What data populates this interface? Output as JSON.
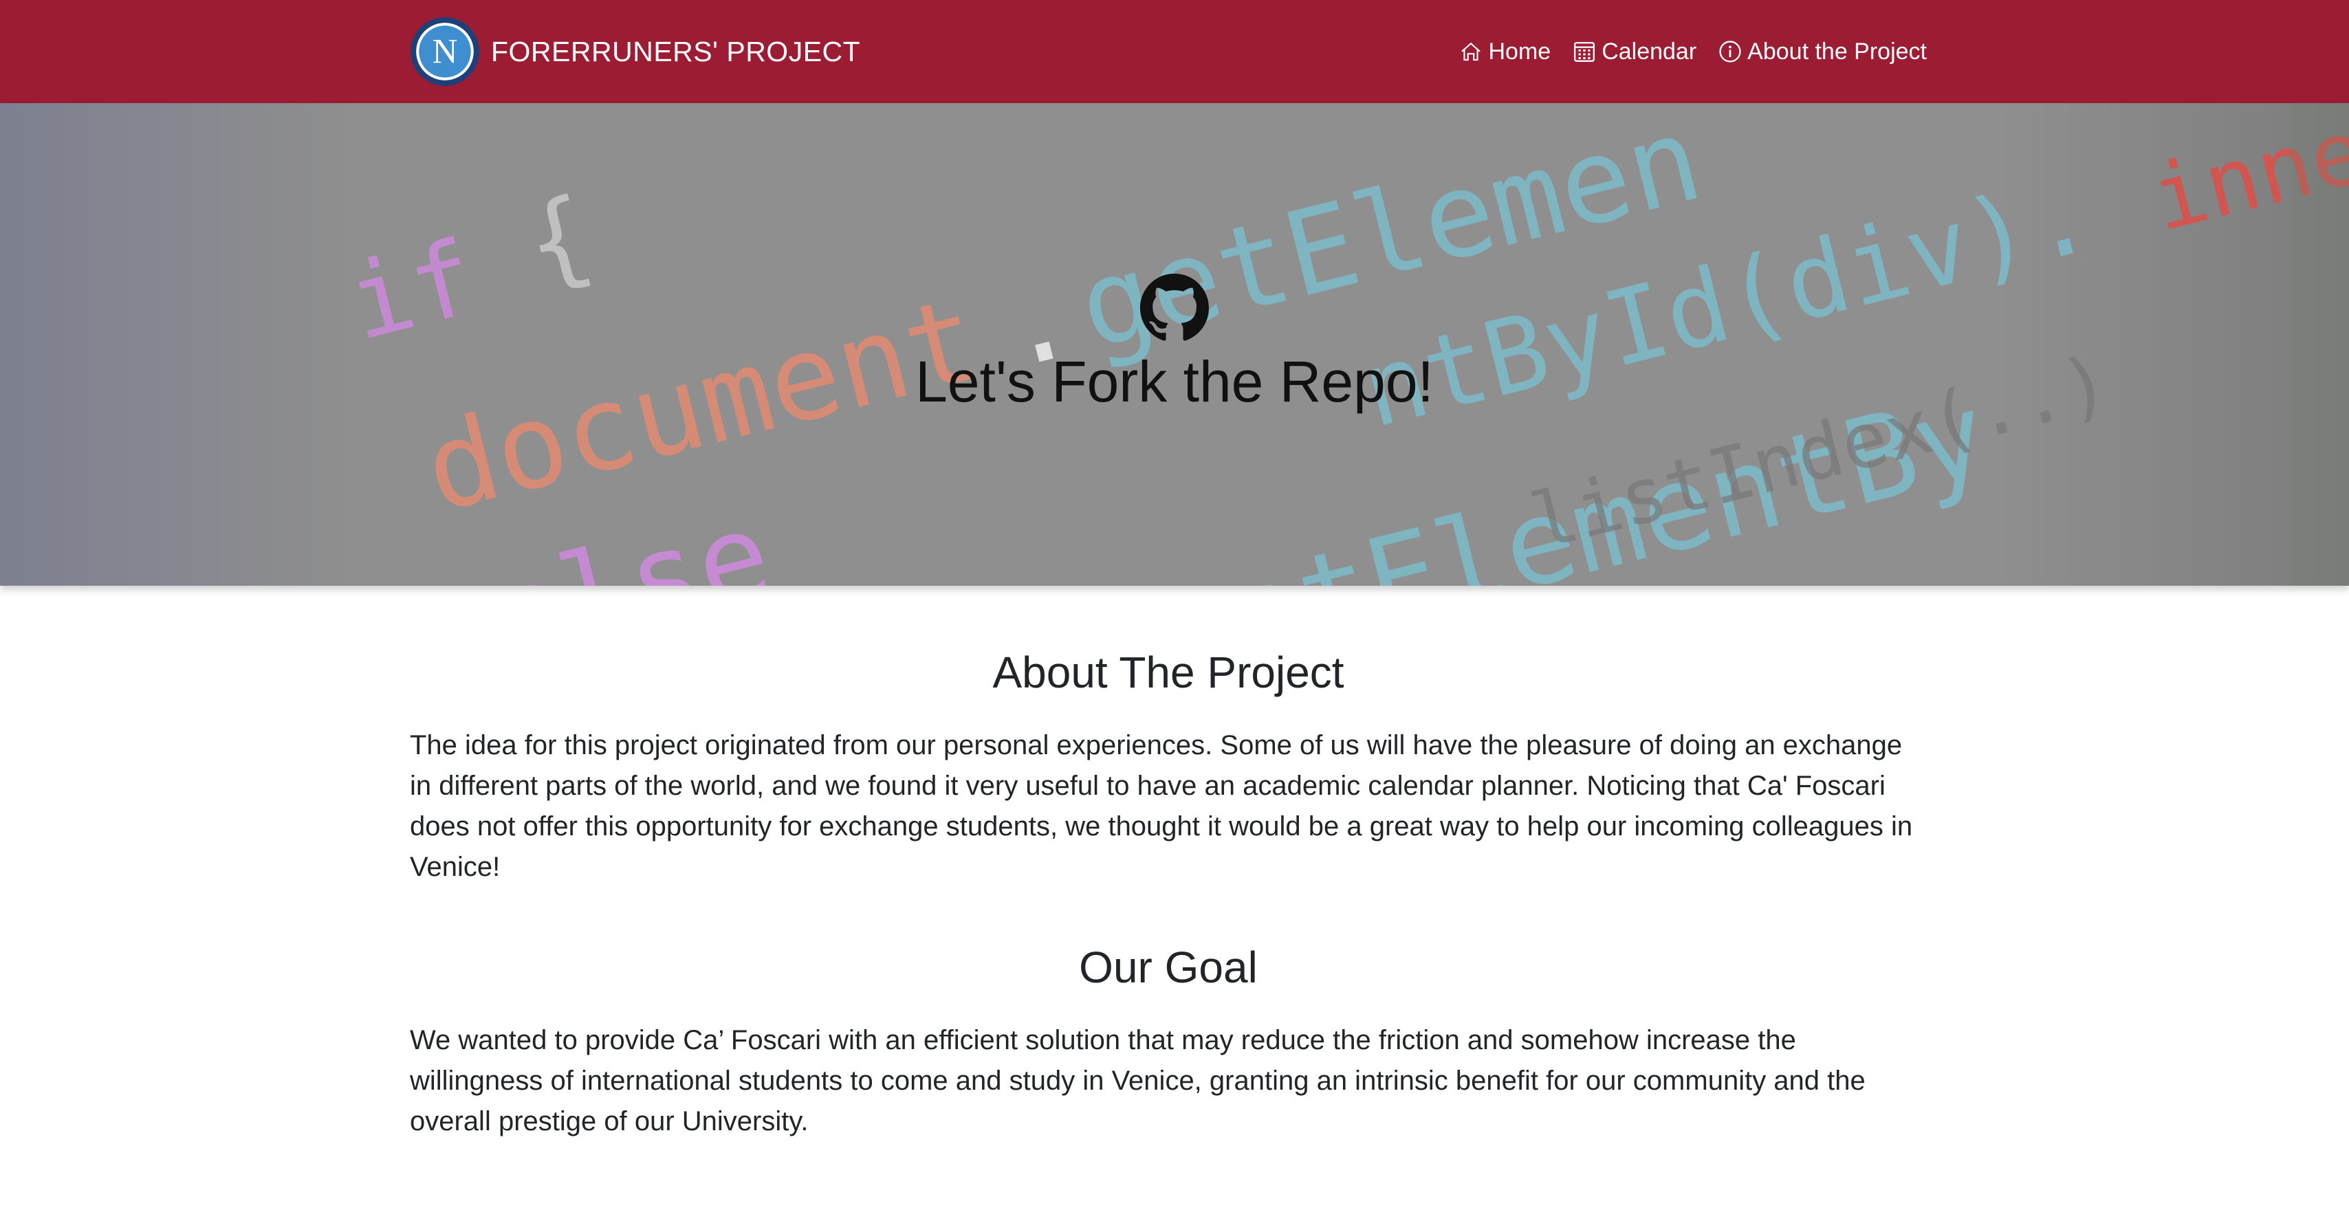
{
  "navbar": {
    "brand_text": "FORERRUNERS' PROJECT",
    "logo_letter": "N",
    "links": [
      {
        "label": "Home",
        "icon": "house-icon"
      },
      {
        "label": "Calendar",
        "icon": "calendar-icon"
      },
      {
        "label": "About the Project",
        "icon": "info-circle-icon"
      }
    ]
  },
  "hero": {
    "icon": "github-icon",
    "title": "Let's Fork the Repo!",
    "background_code": {
      "line1_keyword": "if",
      "line1_brace": "{",
      "line2_obj": "document",
      "line2_method": "getElemen",
      "line3_method": "ntById(div).",
      "line3_prop": "innerHTM",
      "line4_keyword": "else",
      "line5_obj": "cument",
      "line5_method": "getElementBy",
      "line5_dim": "listIndex(..)"
    }
  },
  "sections": [
    {
      "title": "About The Project",
      "text": "The idea for this project originated from our personal experiences. Some of us will have the pleasure of doing an exchange in different parts of the world, and we found it very useful to have an academic calendar planner. Noticing that Ca' Foscari does not offer this opportunity for exchange students, we thought it would be a great way to help our incoming colleagues in Venice!"
    },
    {
      "title": "Our Goal",
      "text": "We wanted to provide Ca’ Foscari with an efficient solution that may reduce the friction and somehow increase the willingness of international students to come and study in Venice, granting an intrinsic benefit for our community and the overall prestige of our University."
    }
  ],
  "colors": {
    "navbar_bg": "#9b1c33",
    "hero_overlay": "#8f8f8f",
    "text": "#212529",
    "code_orange": "#d98b74",
    "code_blue": "#7fb6c4",
    "code_purple": "#c98ad6"
  }
}
